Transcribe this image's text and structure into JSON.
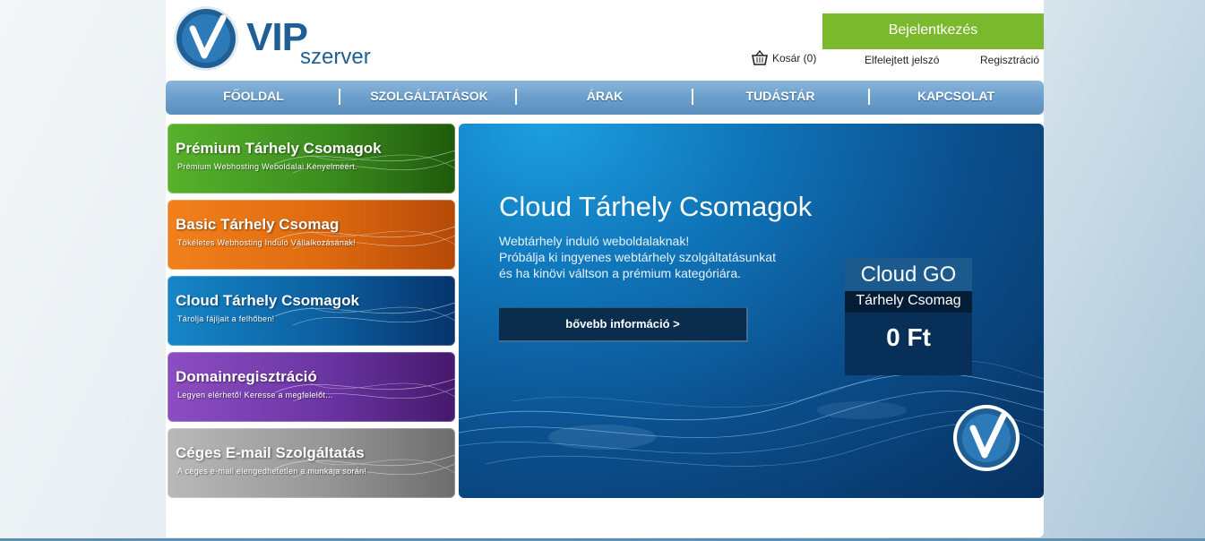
{
  "header": {
    "logo_main": "VIP",
    "logo_sub": "szerver",
    "login_label": "Bejelentkezés",
    "cart_label": "Kosár (0)",
    "forgot_label": "Elfelejtett jelszó",
    "register_label": "Regisztráció"
  },
  "nav": {
    "items": [
      {
        "label": "FŐOLDAL"
      },
      {
        "label": "SZOLGÁLTATÁSOK"
      },
      {
        "label": "ÁRAK"
      },
      {
        "label": "TUDÁSTÁR"
      },
      {
        "label": "KAPCSOLAT"
      }
    ]
  },
  "tiles": [
    {
      "title": "Prémium Tárhely Csomagok",
      "subtitle": "Prémium Webhosting Weboldalai Kényelméért.",
      "color": "#3c8d1e"
    },
    {
      "title": "Basic Tárhely Csomag",
      "subtitle": "Tökéletes Webhosting Induló Vállalkozásának!",
      "color": "#de6a10"
    },
    {
      "title": "Cloud Tárhely Csomagok",
      "subtitle": "Tárolja fájljait a felhőben!",
      "color": "#0c5f9f"
    },
    {
      "title": "Domainregisztráció",
      "subtitle": "Legyen elérhető! Keresse a megfelelőt...",
      "color": "#6b35a3"
    },
    {
      "title": "Céges E-mail Szolgáltatás",
      "subtitle": "A céges e-mail elengedhetetlen a munkája során!",
      "color": "#969696"
    }
  ],
  "banner": {
    "title": "Cloud Tárhely Csomagok",
    "desc_line1": "Webtárhely induló weboldalaknak!",
    "desc_line2": "Próbálja ki ingyenes webtárhely szolgáltatásunkat",
    "desc_line3": "és ha kinövi váltson a prémium kategóriára.",
    "button_label": "bővebb információ >",
    "package_name": "Cloud GO",
    "package_type": "Tárhely Csomag",
    "package_price": "0 Ft"
  },
  "colors": {
    "brand_blue": "#1f5f95",
    "login_green": "#7ab82e",
    "nav_blue": "#6b9ecb"
  }
}
